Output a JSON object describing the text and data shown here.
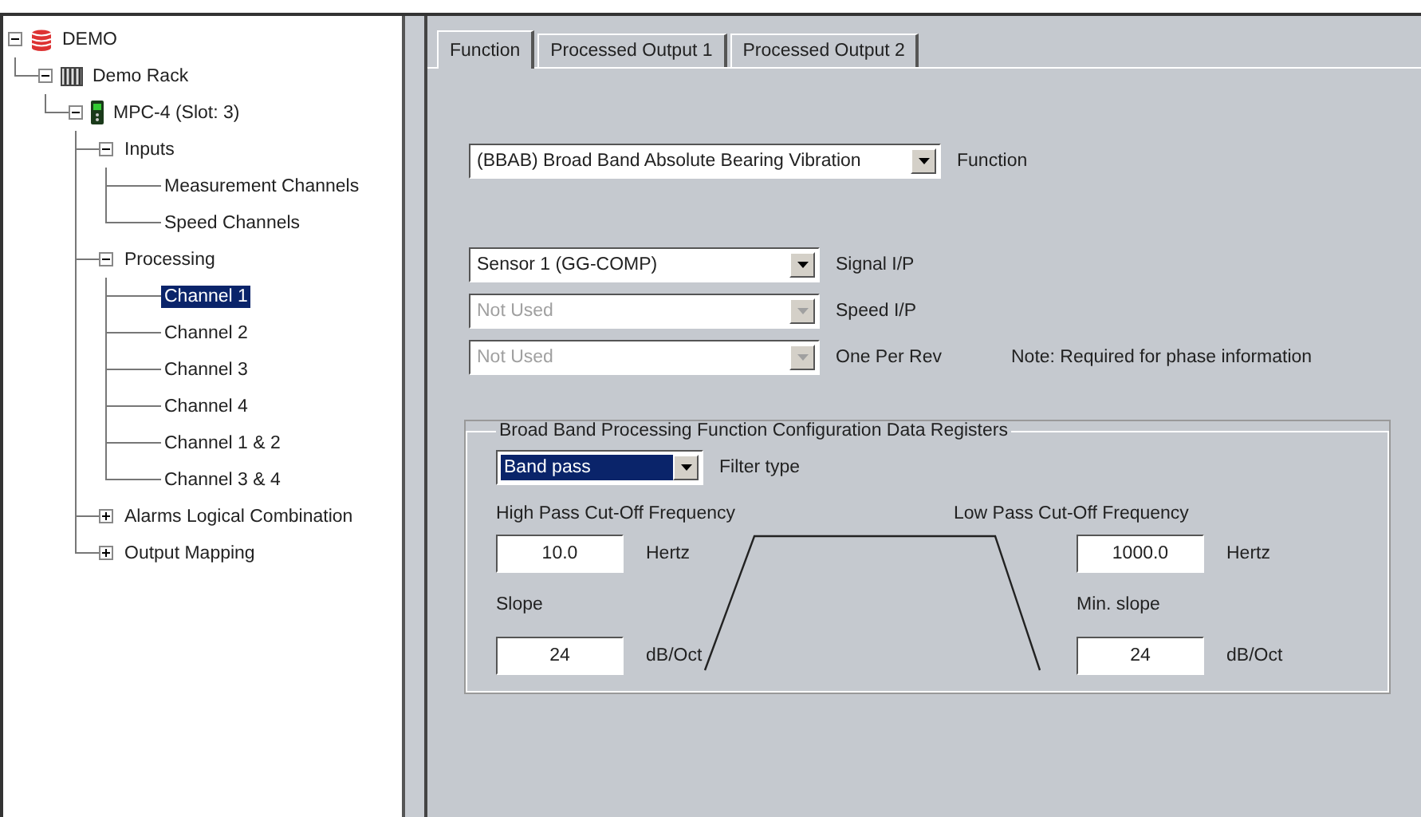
{
  "tree": [
    {
      "label": "DEMO",
      "kind": "database",
      "expanded": true,
      "selected": false,
      "children": [
        {
          "label": "Demo Rack",
          "kind": "rack",
          "expanded": true,
          "selected": false,
          "children": [
            {
              "label": "MPC-4 (Slot: 3)",
              "kind": "module",
              "expanded": true,
              "selected": false,
              "children": [
                {
                  "label": "Inputs",
                  "expanded": true,
                  "selected": false,
                  "children": [
                    {
                      "label": "Measurement Channels",
                      "selected": false
                    },
                    {
                      "label": "Speed Channels",
                      "selected": false
                    }
                  ]
                },
                {
                  "label": "Processing",
                  "expanded": true,
                  "selected": false,
                  "children": [
                    {
                      "label": "Channel 1",
                      "selected": true
                    },
                    {
                      "label": "Channel 2",
                      "selected": false
                    },
                    {
                      "label": "Channel 3",
                      "selected": false
                    },
                    {
                      "label": "Channel 4",
                      "selected": false
                    },
                    {
                      "label": "Channel 1 & 2",
                      "selected": false
                    },
                    {
                      "label": "Channel 3 & 4",
                      "selected": false
                    }
                  ]
                },
                {
                  "label": "Alarms Logical Combination",
                  "expanded": false,
                  "selected": false
                },
                {
                  "label": "Output Mapping",
                  "expanded": false,
                  "selected": false
                }
              ]
            }
          ]
        }
      ]
    }
  ],
  "tabs": [
    {
      "label": "Function",
      "selected": true
    },
    {
      "label": "Processed Output 1",
      "selected": false
    },
    {
      "label": "Processed Output 2",
      "selected": false
    }
  ],
  "function_select": {
    "value": "(BBAB) Broad Band Absolute Bearing Vibration",
    "label": "Function"
  },
  "inputs": [
    {
      "value": "Sensor 1 (GG-COMP)",
      "label": "Signal I/P",
      "disabled": false
    },
    {
      "value": "Not Used",
      "label": "Speed I/P",
      "disabled": true
    },
    {
      "value": "Not Used",
      "label": "One Per Rev",
      "disabled": true,
      "note": "Note: Required for phase information"
    }
  ],
  "group": {
    "title": "Broad Band Processing Function Configuration Data Registers",
    "filter": {
      "value": "Band pass",
      "label": "Filter type",
      "focused": true
    },
    "high_pass": {
      "heading": "High Pass Cut-Off Frequency",
      "frequency": "10.0",
      "frequency_unit": "Hertz",
      "slope_label": "Slope",
      "slope": "24",
      "slope_unit": "dB/Oct"
    },
    "low_pass": {
      "heading": "Low Pass Cut-Off Frequency",
      "frequency": "1000.0",
      "frequency_unit": "Hertz",
      "slope_label": "Min. slope",
      "slope": "24",
      "slope_unit": "dB/Oct"
    }
  }
}
